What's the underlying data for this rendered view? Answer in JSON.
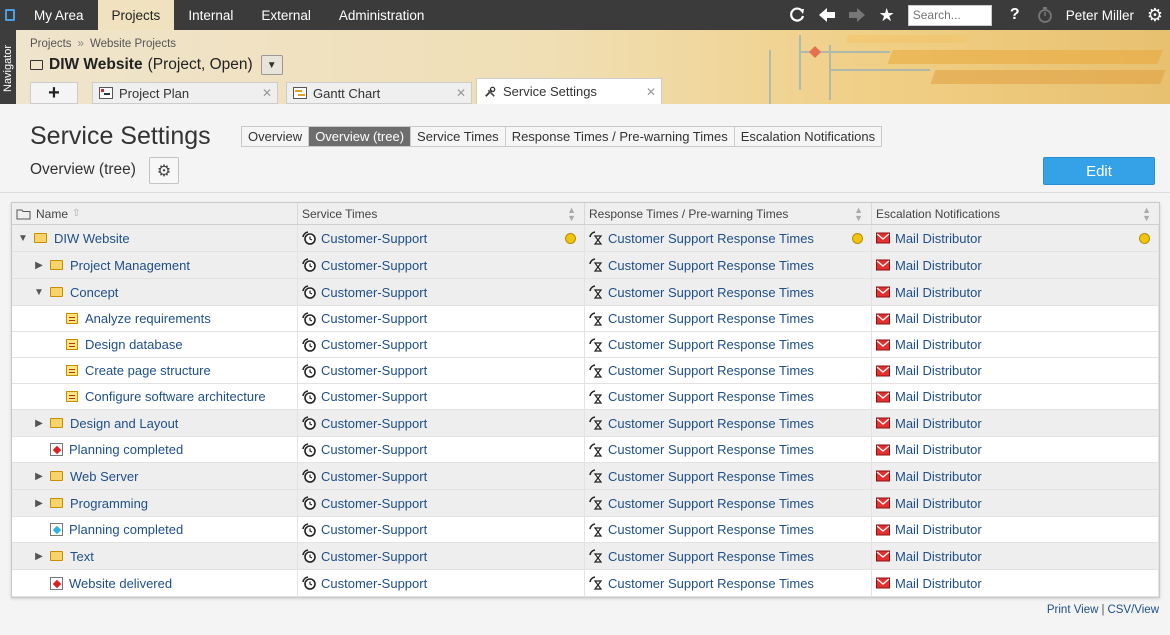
{
  "topnav": {
    "items": [
      "My Area",
      "Projects",
      "Internal",
      "External",
      "Administration"
    ],
    "active_index": 1,
    "search_placeholder": "Search...",
    "user": "Peter Miller"
  },
  "navigator": {
    "label": "Navigator"
  },
  "header": {
    "breadcrumb": [
      "Projects",
      "Website Projects"
    ],
    "project_name": "DIW Website",
    "project_status": "(Project, Open)",
    "add_tab": "+",
    "tabs": [
      {
        "label": "Project Plan",
        "close": "✕"
      },
      {
        "label": "Gantt Chart",
        "close": "✕"
      },
      {
        "label": "Service Settings",
        "close": "✕"
      }
    ]
  },
  "page": {
    "title": "Service Settings",
    "subtabs": [
      "Overview",
      "Overview (tree)",
      "Service Times",
      "Response Times / Pre-warning Times",
      "Escalation Notifications"
    ],
    "active_subtab": 1,
    "view_title": "Overview (tree)",
    "edit_label": "Edit"
  },
  "grid": {
    "columns": [
      "Name",
      "Service Times",
      "Response Times / Pre-warning Times",
      "Escalation Notifications"
    ],
    "rows": [
      {
        "name": "DIW Website",
        "level": 0,
        "type": "folder",
        "toggle": "down",
        "service": "Customer-Support",
        "response": "Customer Support Response Times",
        "escalation": "Mail Distributor",
        "status_dot": true
      },
      {
        "name": "Project Management",
        "level": 1,
        "type": "folder",
        "toggle": "right",
        "service": "Customer-Support",
        "response": "Customer Support Response Times",
        "escalation": "Mail Distributor"
      },
      {
        "name": "Concept",
        "level": 1,
        "type": "folder",
        "toggle": "down",
        "service": "Customer-Support",
        "response": "Customer Support Response Times",
        "escalation": "Mail Distributor"
      },
      {
        "name": "Analyze requirements",
        "level": 2,
        "type": "task",
        "toggle": "",
        "service": "Customer-Support",
        "response": "Customer Support Response Times",
        "escalation": "Mail Distributor"
      },
      {
        "name": "Design database",
        "level": 2,
        "type": "task",
        "toggle": "",
        "service": "Customer-Support",
        "response": "Customer Support Response Times",
        "escalation": "Mail Distributor"
      },
      {
        "name": "Create page structure",
        "level": 2,
        "type": "task",
        "toggle": "",
        "service": "Customer-Support",
        "response": "Customer Support Response Times",
        "escalation": "Mail Distributor"
      },
      {
        "name": "Configure software architecture",
        "level": 2,
        "type": "task",
        "toggle": "",
        "service": "Customer-Support",
        "response": "Customer Support Response Times",
        "escalation": "Mail Distributor"
      },
      {
        "name": "Design and Layout",
        "level": 1,
        "type": "folder",
        "toggle": "right",
        "service": "Customer-Support",
        "response": "Customer Support Response Times",
        "escalation": "Mail Distributor"
      },
      {
        "name": "Planning completed",
        "level": 1,
        "type": "milestone-red",
        "toggle": "",
        "service": "Customer-Support",
        "response": "Customer Support Response Times",
        "escalation": "Mail Distributor"
      },
      {
        "name": "Web Server",
        "level": 1,
        "type": "folder",
        "toggle": "right",
        "service": "Customer-Support",
        "response": "Customer Support Response Times",
        "escalation": "Mail Distributor"
      },
      {
        "name": "Programming",
        "level": 1,
        "type": "folder",
        "toggle": "right",
        "service": "Customer-Support",
        "response": "Customer Support Response Times",
        "escalation": "Mail Distributor"
      },
      {
        "name": "Planning completed",
        "level": 1,
        "type": "milestone-blue",
        "toggle": "",
        "service": "Customer-Support",
        "response": "Customer Support Response Times",
        "escalation": "Mail Distributor"
      },
      {
        "name": "Text",
        "level": 1,
        "type": "folder",
        "toggle": "right",
        "service": "Customer-Support",
        "response": "Customer Support Response Times",
        "escalation": "Mail Distributor"
      },
      {
        "name": "Website delivered",
        "level": 1,
        "type": "milestone-red",
        "toggle": "",
        "service": "Customer-Support",
        "response": "Customer Support Response Times",
        "escalation": "Mail Distributor"
      }
    ]
  },
  "footer": {
    "print": "Print View",
    "csv": "CSV/View"
  },
  "colors": {
    "accent": "#35a2e8",
    "link": "#1e4f8a",
    "topbar": "#3b3b3b",
    "status_dot": "#f1c40f"
  }
}
